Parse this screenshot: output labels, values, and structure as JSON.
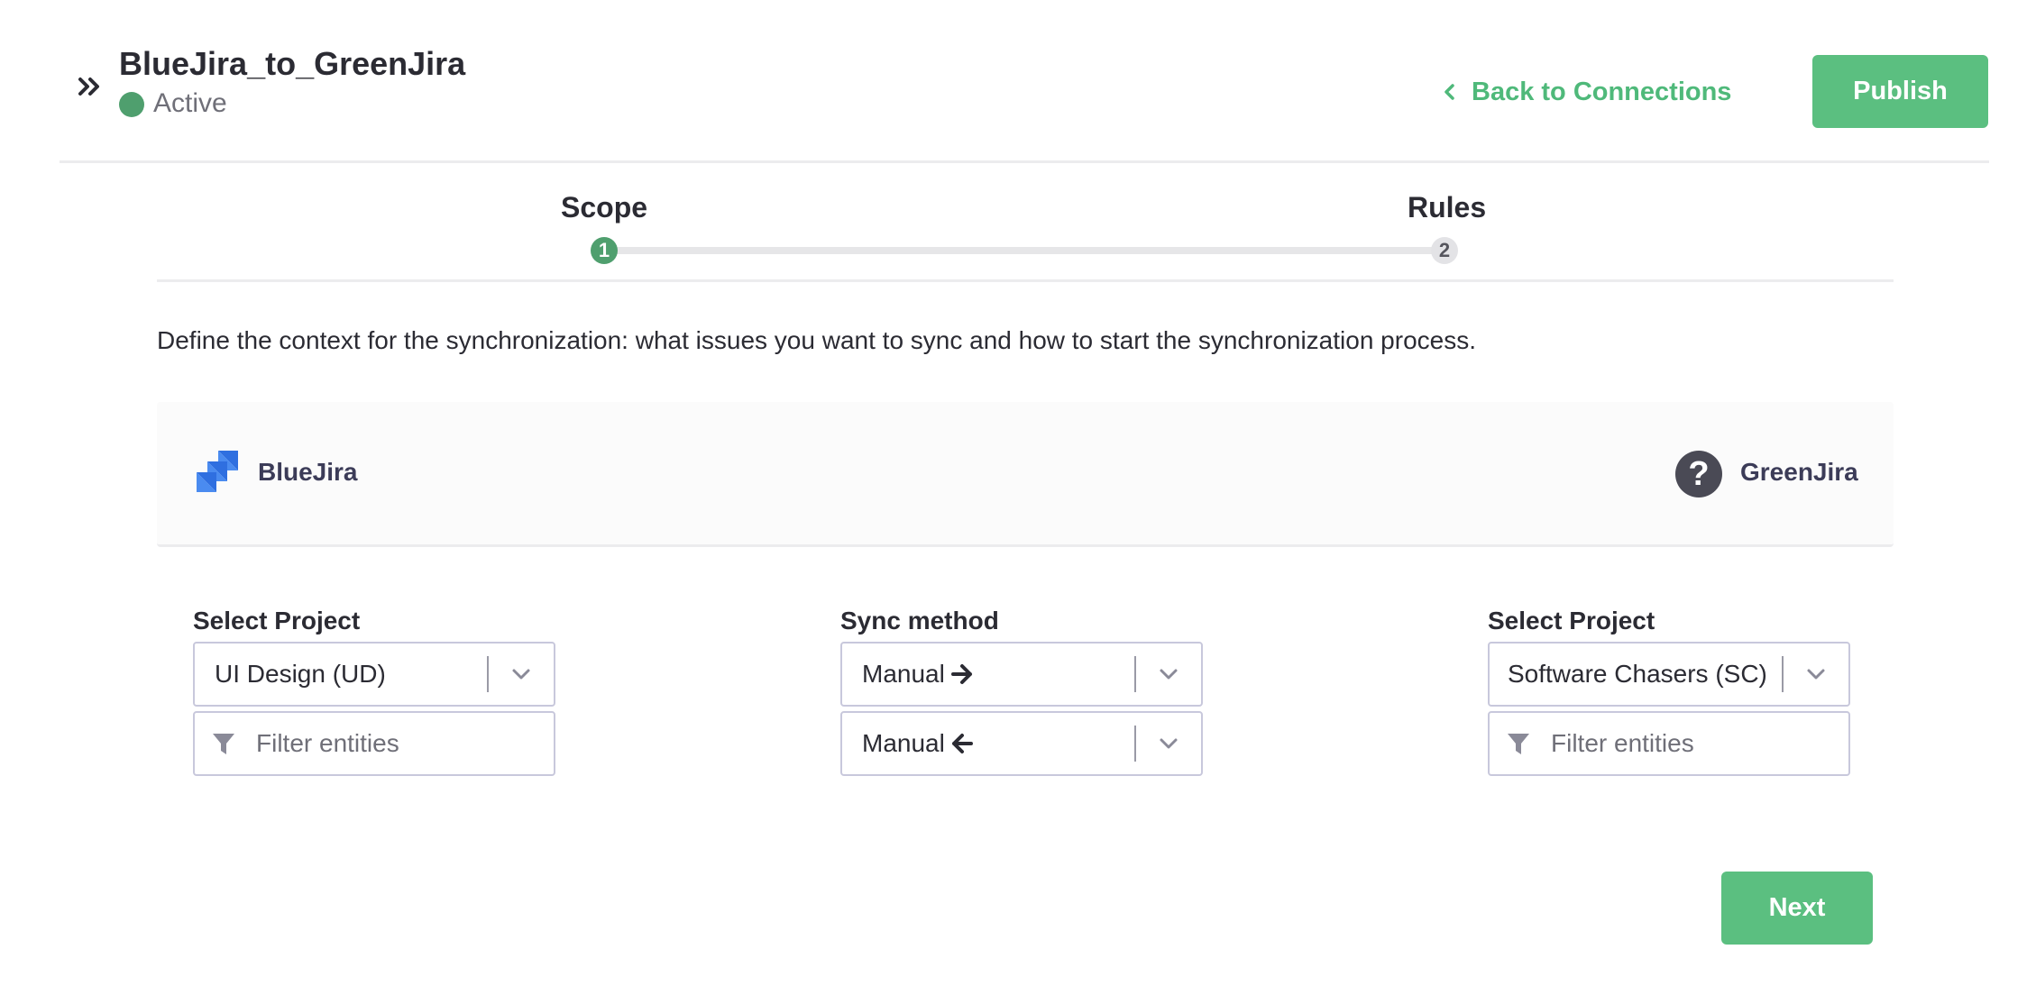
{
  "header": {
    "connection_name": "BlueJira_to_GreenJira",
    "status": "Active",
    "status_color": "#4f9f6e",
    "back_link": "Back to Connections",
    "publish_label": "Publish",
    "collapse_icon": "double-chevron-right-icon"
  },
  "stepper": {
    "steps": [
      {
        "label": "Scope",
        "number": "1",
        "state": "active"
      },
      {
        "label": "Rules",
        "number": "2",
        "state": "inactive"
      }
    ],
    "progress": 0
  },
  "description": "Define the context for the synchronization: what issues you want to sync and how to start the synchronization process.",
  "instances": {
    "left": {
      "name": "BlueJira",
      "icon": "jira-logo-icon"
    },
    "right": {
      "name": "GreenJira",
      "icon": "question-icon"
    }
  },
  "left_panel": {
    "label": "Select Project",
    "project_value": "UI Design (UD)",
    "filter_placeholder": "Filter entities"
  },
  "sync_method": {
    "label": "Sync method",
    "outgoing_value": "Manual",
    "incoming_value": "Manual"
  },
  "right_panel": {
    "label": "Select Project",
    "project_value": "Software Chasers (SC)",
    "filter_placeholder": "Filter entities"
  },
  "footer": {
    "next_label": "Next"
  },
  "colors": {
    "accent": "#5bbf80",
    "link": "#4fb97a",
    "active_step": "#4f9f6e"
  }
}
